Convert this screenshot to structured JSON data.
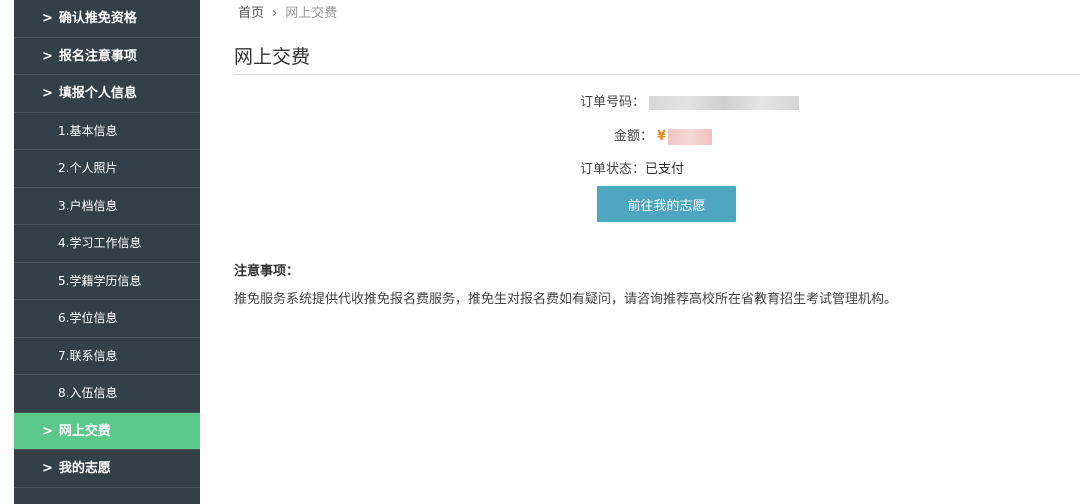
{
  "sidebar": {
    "items": [
      {
        "label": "确认推免资格",
        "level": "top",
        "chevron": ">",
        "active": false
      },
      {
        "label": "报名注意事项",
        "level": "top",
        "chevron": ">",
        "active": false
      },
      {
        "label": "填报个人信息",
        "level": "top",
        "chevron": ">",
        "active": false
      },
      {
        "label": "1.基本信息",
        "level": "sub",
        "active": false
      },
      {
        "label": "2.个人照片",
        "level": "sub",
        "active": false
      },
      {
        "label": "3.户档信息",
        "level": "sub",
        "active": false
      },
      {
        "label": "4.学习工作信息",
        "level": "sub",
        "active": false
      },
      {
        "label": "5.学籍学历信息",
        "level": "sub",
        "active": false
      },
      {
        "label": "6.学位信息",
        "level": "sub",
        "active": false
      },
      {
        "label": "7.联系信息",
        "level": "sub",
        "active": false
      },
      {
        "label": "8.入伍信息",
        "level": "sub",
        "active": false
      },
      {
        "label": "网上交费",
        "level": "top",
        "chevron": ">",
        "active": true
      },
      {
        "label": "我的志愿",
        "level": "top",
        "chevron": ">",
        "active": false
      }
    ],
    "colors": {
      "background": "#344048",
      "active": "#5cc88a"
    }
  },
  "breadcrumb": {
    "home": "首页",
    "separator": "›",
    "current": "网上交费"
  },
  "page": {
    "title": "网上交费"
  },
  "order": {
    "number_label": "订单号码",
    "amount_label": "金额",
    "currency_symbol": "¥",
    "status_label": "订单状态",
    "status_value": "已支付",
    "colon": "："
  },
  "actions": {
    "goto_wishes_label": "前往我的志愿",
    "button_color": "#4fa6c0"
  },
  "notes": {
    "title": "注意事项：",
    "text": "推免服务系统提供代收推免报名费服务，推免生对报名费如有疑问，请咨询推荐高校所在省教育招生考试管理机构。"
  }
}
